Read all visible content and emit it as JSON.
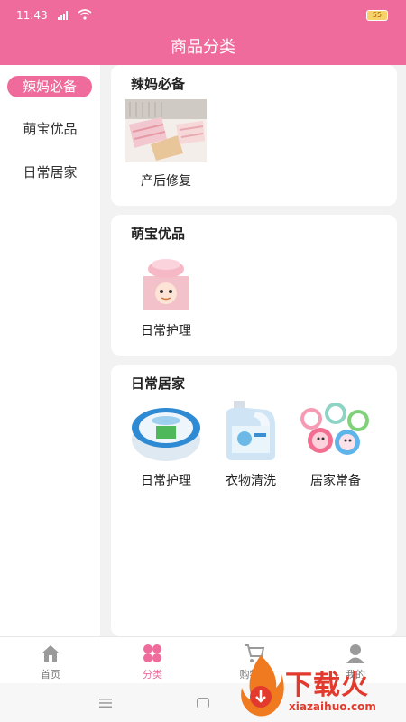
{
  "status_bar": {
    "time": "11:43",
    "battery": "55"
  },
  "header": {
    "title": "商品分类"
  },
  "sidebar": {
    "items": [
      {
        "label": "辣妈必备",
        "active": true
      },
      {
        "label": "萌宝优品",
        "active": false
      },
      {
        "label": "日常居家",
        "active": false
      }
    ]
  },
  "sections": [
    {
      "title": "辣妈必备",
      "items": [
        {
          "label": "产后修复",
          "icon": "postpartum-belt-image"
        }
      ]
    },
    {
      "title": "萌宝优品",
      "items": [
        {
          "label": "日常护理",
          "icon": "baby-cream-jar-image"
        }
      ]
    },
    {
      "title": "日常居家",
      "items": [
        {
          "label": "日常护理",
          "icon": "detergent-tub-image"
        },
        {
          "label": "衣物清洗",
          "icon": "laundry-bottle-image"
        },
        {
          "label": "居家常备",
          "icon": "mosquito-repellent-image"
        }
      ]
    }
  ],
  "bottom_nav": {
    "items": [
      {
        "label": "首页",
        "icon": "home-icon"
      },
      {
        "label": "分类",
        "icon": "category-icon",
        "active": true
      },
      {
        "label": "购物车",
        "icon": "cart-icon"
      },
      {
        "label": "我的",
        "icon": "user-icon"
      }
    ]
  },
  "watermark": {
    "brand": "下载火",
    "url": "xiazaihuo.com"
  },
  "colors": {
    "accent": "#ef6b9b",
    "background": "#f2f2f2"
  }
}
